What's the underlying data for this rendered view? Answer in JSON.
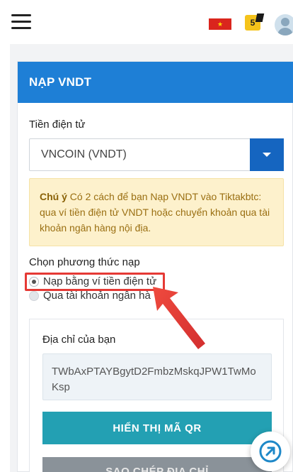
{
  "topbar": {
    "flag_star": "★",
    "notification_count": "5"
  },
  "card": {
    "title": "NẠP VNDT",
    "crypto_label": "Tiền điện tử",
    "crypto_selected": "VNCOIN (VNDT)",
    "notice_bold": "Chú ý",
    "notice_text": " Có 2 cách để bạn Nạp VNDT vào Tiktakbtc: qua ví tiền điện tử VNDT hoặc chuyển khoản qua tài khoản ngân hàng nội địa.",
    "method_label": "Chọn phương thức nạp",
    "method_options": [
      {
        "label": "Nạp bằng ví tiền điện tử",
        "checked": true
      },
      {
        "label": "Qua tài khoản ngân hà",
        "checked": false
      }
    ],
    "address_label": "Địa chỉ của bạn",
    "address_value": "TWbAxPTAYBgytD2FmbzMskqJPW1TwMoKsp",
    "qr_button": "HIỂN THỊ MÃ QR",
    "copy_button": "SAO CHÉP ĐỊA CHỈ"
  },
  "colors": {
    "header_blue": "#1e7fd6",
    "select_button": "#1565c0",
    "qr_button": "#23a0b3",
    "highlight_red": "#e53935"
  },
  "icons": {
    "menu": "hamburger-menu-icon",
    "flag": "vietnam-flag-icon",
    "notification": "notification-badge-icon",
    "avatar": "user-avatar-icon",
    "dropdown": "caret-down-icon",
    "fab": "external-link-icon"
  }
}
